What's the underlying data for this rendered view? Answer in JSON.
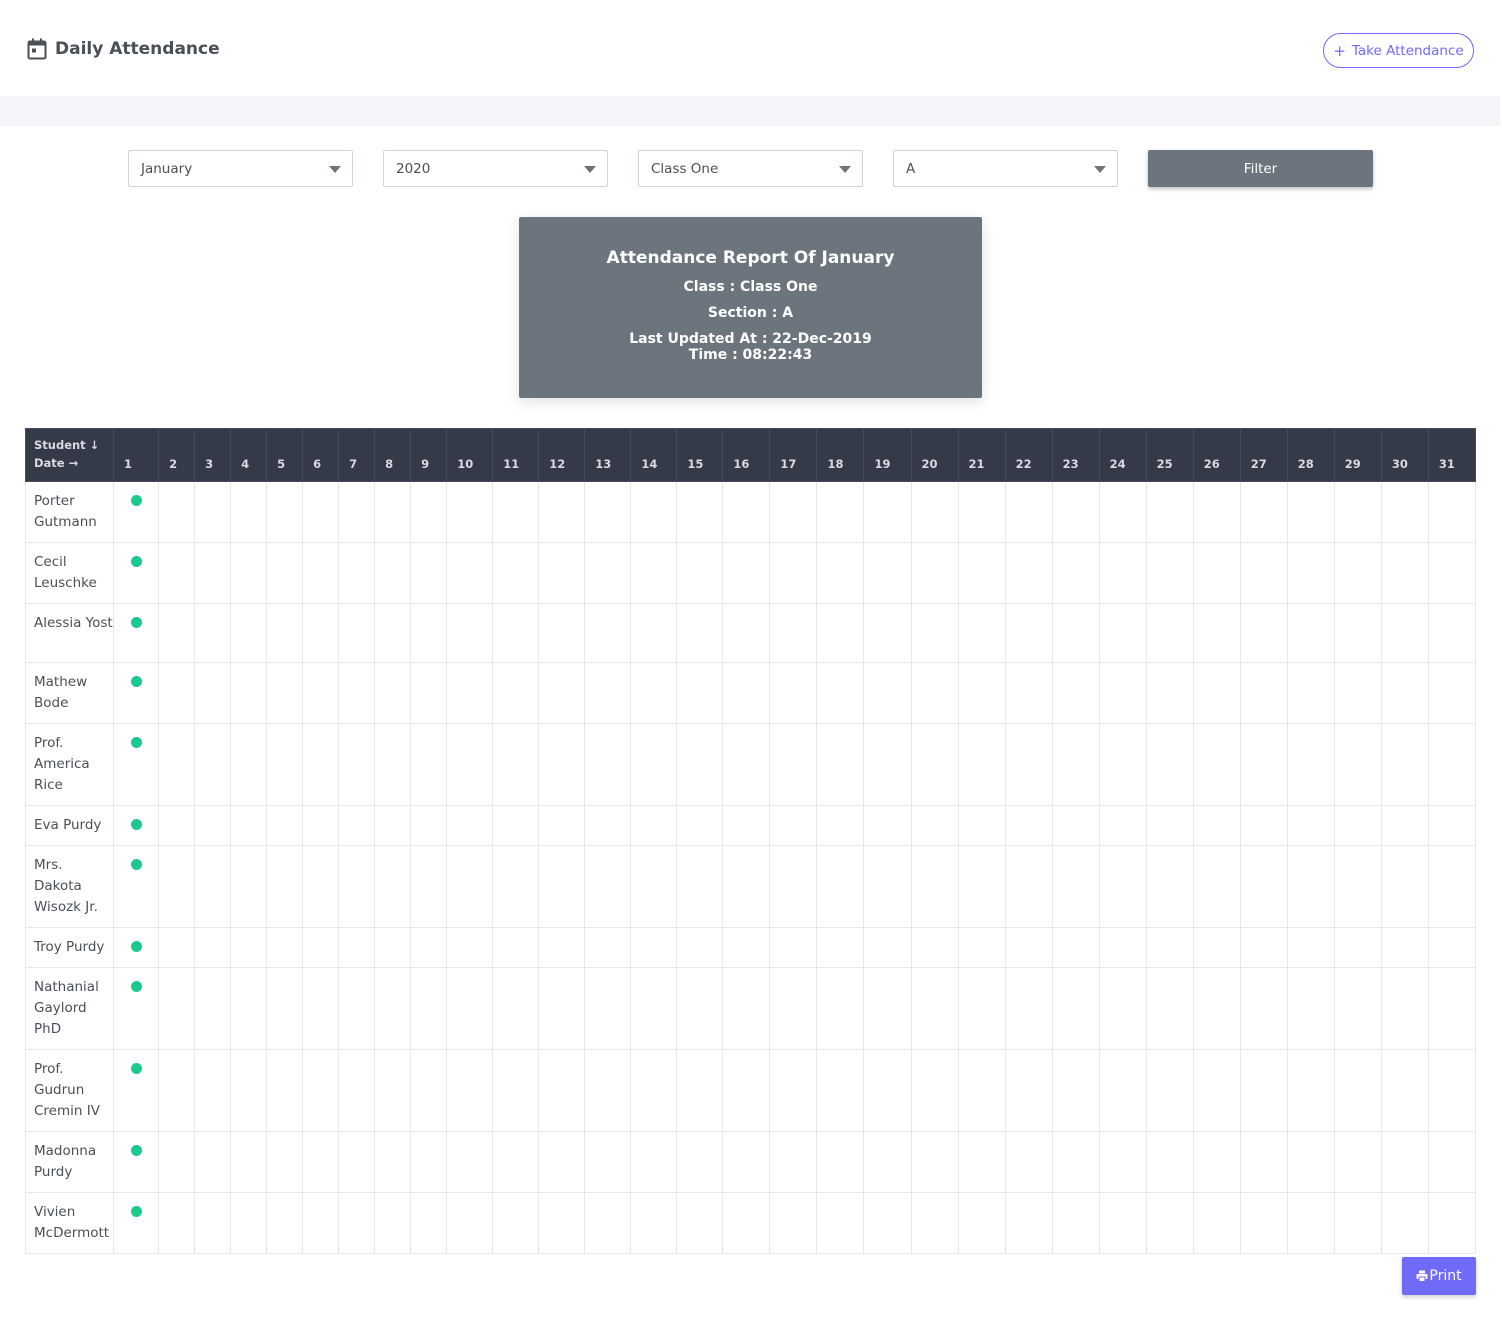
{
  "header": {
    "title": "Daily Attendance",
    "title_icon": "calendar-icon",
    "take_attendance_label": "Take Attendance",
    "take_attendance_icon": "plus-icon"
  },
  "filters": {
    "month": "January",
    "year": "2020",
    "class": "Class One",
    "section": "A",
    "filter_label": "Filter"
  },
  "report": {
    "title": "Attendance Report Of January",
    "class_line": "Class : Class One",
    "section_line": "Section : A",
    "updated_line": "Last Updated At : 22-Dec-2019",
    "time_line": "Time : 08:22:43"
  },
  "table": {
    "corner_student": "Student ↓",
    "corner_date": "Date →",
    "days": [
      "1",
      "2",
      "3",
      "4",
      "5",
      "6",
      "7",
      "8",
      "9",
      "10",
      "11",
      "12",
      "13",
      "14",
      "15",
      "16",
      "17",
      "18",
      "19",
      "20",
      "21",
      "22",
      "23",
      "24",
      "25",
      "26",
      "27",
      "28",
      "29",
      "30",
      "31"
    ],
    "students": [
      {
        "name": "Porter Gutmann",
        "present_days": [
          1
        ]
      },
      {
        "name": "Cecil Leuschke",
        "present_days": [
          1
        ]
      },
      {
        "name": "Alessia Yost",
        "present_days": [
          1
        ]
      },
      {
        "name": "Mathew Bode",
        "present_days": [
          1
        ]
      },
      {
        "name": "Prof. America Rice",
        "present_days": [
          1
        ]
      },
      {
        "name": "Eva Purdy",
        "present_days": [
          1
        ]
      },
      {
        "name": "Mrs. Dakota Wisozk Jr.",
        "present_days": [
          1
        ]
      },
      {
        "name": "Troy Purdy",
        "present_days": [
          1
        ]
      },
      {
        "name": "Nathanial Gaylord PhD",
        "present_days": [
          1
        ]
      },
      {
        "name": "Prof. Gudrun Cremin IV",
        "present_days": [
          1
        ]
      },
      {
        "name": "Madonna Purdy",
        "present_days": [
          1
        ]
      },
      {
        "name": "Vivien McDermott",
        "present_days": [
          1
        ]
      }
    ]
  },
  "print": {
    "label": "Print",
    "icon": "printer-icon"
  },
  "colors": {
    "accent": "#6f6af8",
    "present_dot": "#1bc98e",
    "header_bg": "#343a48",
    "card_bg": "#6c757d"
  }
}
